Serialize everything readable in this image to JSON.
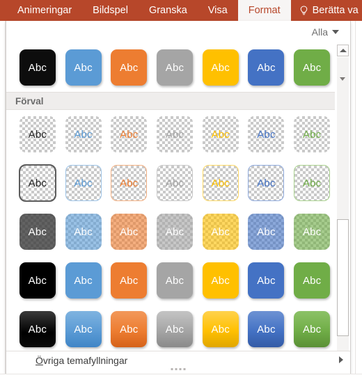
{
  "ribbon": {
    "tabs": [
      {
        "label": "Animeringar",
        "active": false
      },
      {
        "label": "Bildspel",
        "active": false
      },
      {
        "label": "Granska",
        "active": false
      },
      {
        "label": "Visa",
        "active": false
      },
      {
        "label": "Format",
        "active": true
      }
    ],
    "tell_me": {
      "label": "Berätta va",
      "icon": "lightbulb-icon"
    },
    "background_color": "#b7472a",
    "active_tab_background": "#f7f5f4"
  },
  "gallery": {
    "filter": {
      "label": "Alla",
      "icon": "chevron-down-icon"
    },
    "section_header": "Förval",
    "swatch_label": "Abc",
    "rows": [
      {
        "name": "recent-solid",
        "style": "solid",
        "items": [
          {
            "fill": "#0d0d0d",
            "text": "#ffffff",
            "selected": false
          },
          {
            "fill": "#5b9bd5",
            "text": "#ffffff",
            "selected": false
          },
          {
            "fill": "#ed7d31",
            "text": "#ffffff",
            "selected": false
          },
          {
            "fill": "#a5a5a5",
            "text": "#ffffff",
            "selected": false
          },
          {
            "fill": "#ffc000",
            "text": "#ffffff",
            "selected": false
          },
          {
            "fill": "#4472c4",
            "text": "#ffffff",
            "selected": false
          },
          {
            "fill": "#70ad47",
            "text": "#ffffff",
            "selected": false
          }
        ]
      },
      {
        "name": "no-fill-no-line",
        "style": "transparent",
        "items": [
          {
            "fill": "transparent",
            "text": "#262626",
            "border": "none",
            "selected": false
          },
          {
            "fill": "transparent",
            "text": "#5b9bd5",
            "border": "none",
            "selected": false
          },
          {
            "fill": "transparent",
            "text": "#ed7d31",
            "border": "none",
            "selected": false
          },
          {
            "fill": "transparent",
            "text": "#a5a5a5",
            "border": "none",
            "selected": false
          },
          {
            "fill": "transparent",
            "text": "#ffc000",
            "border": "none",
            "selected": false
          },
          {
            "fill": "transparent",
            "text": "#4472c4",
            "border": "none",
            "selected": false
          },
          {
            "fill": "transparent",
            "text": "#70ad47",
            "border": "none",
            "selected": false
          }
        ]
      },
      {
        "name": "outline-only",
        "style": "outline",
        "items": [
          {
            "fill": "transparent",
            "text": "#262626",
            "border": "#404040",
            "selected": true
          },
          {
            "fill": "transparent",
            "text": "#5b9bd5",
            "border": "#9dc3e6",
            "selected": false
          },
          {
            "fill": "transparent",
            "text": "#ed7d31",
            "border": "#f4b183",
            "selected": false
          },
          {
            "fill": "transparent",
            "text": "#a5a5a5",
            "border": "#c9c9c9",
            "selected": false
          },
          {
            "fill": "transparent",
            "text": "#ffc000",
            "border": "#ffd966",
            "selected": false
          },
          {
            "fill": "transparent",
            "text": "#4472c4",
            "border": "#8faadc",
            "selected": false
          },
          {
            "fill": "transparent",
            "text": "#70ad47",
            "border": "#a9d18e",
            "selected": false
          }
        ]
      },
      {
        "name": "semi-transparent-fill",
        "style": "semi",
        "items": [
          {
            "fill": "rgba(64,64,64,0.82)",
            "text": "#ffffff",
            "selected": false
          },
          {
            "fill": "rgba(91,155,213,0.62)",
            "text": "#ffffff",
            "selected": false
          },
          {
            "fill": "rgba(237,125,49,0.62)",
            "text": "#ffffff",
            "selected": false
          },
          {
            "fill": "rgba(165,165,165,0.62)",
            "text": "#ffffff",
            "selected": false
          },
          {
            "fill": "rgba(255,192,0,0.62)",
            "text": "#ffffff",
            "selected": false
          },
          {
            "fill": "rgba(68,114,196,0.62)",
            "text": "#ffffff",
            "selected": false
          },
          {
            "fill": "rgba(112,173,71,0.62)",
            "text": "#ffffff",
            "selected": false
          }
        ]
      },
      {
        "name": "solid-fill",
        "style": "solid-flat",
        "items": [
          {
            "fill": "#000000",
            "text": "#ffffff",
            "selected": false
          },
          {
            "fill": "#5b9bd5",
            "text": "#ffffff",
            "selected": false
          },
          {
            "fill": "#ed7d31",
            "text": "#ffffff",
            "selected": false
          },
          {
            "fill": "#a5a5a5",
            "text": "#ffffff",
            "selected": false
          },
          {
            "fill": "#ffc000",
            "text": "#ffffff",
            "selected": false
          },
          {
            "fill": "#4472c4",
            "text": "#ffffff",
            "selected": false
          },
          {
            "fill": "#70ad47",
            "text": "#ffffff",
            "selected": false
          }
        ]
      },
      {
        "name": "gradient-fill",
        "style": "gradient",
        "items": [
          {
            "fill": "linear-gradient(180deg,#3a3a3a 0%,#000000 60%,#0a0a0a 100%)",
            "text": "#ffffff",
            "selected": false
          },
          {
            "fill": "linear-gradient(180deg,#7fb3e0 0%,#5b9bd5 55%,#3f85c6 100%)",
            "text": "#ffffff",
            "selected": false
          },
          {
            "fill": "linear-gradient(180deg,#f2985a 0%,#ed7d31 55%,#d5621a 100%)",
            "text": "#ffffff",
            "selected": false
          },
          {
            "fill": "linear-gradient(180deg,#c4c4c4 0%,#a5a5a5 55%,#8a8a8a 100%)",
            "text": "#ffffff",
            "selected": false
          },
          {
            "fill": "linear-gradient(180deg,#ffd24d 0%,#ffc000 55%,#e0a600 100%)",
            "text": "#ffffff",
            "selected": false
          },
          {
            "fill": "linear-gradient(180deg,#6d92d3 0%,#4472c4 55%,#335ba6 100%)",
            "text": "#ffffff",
            "selected": false
          },
          {
            "fill": "linear-gradient(180deg,#8cc267 0%,#70ad47 55%,#5a9036 100%)",
            "text": "#ffffff",
            "selected": false
          }
        ]
      }
    ],
    "footer": {
      "more_fills": {
        "accel": "Ö",
        "rest": "vriga temafyllningar",
        "icon": "submenu-arrow-icon"
      }
    },
    "scrollbar": {
      "up_icon": "scroll-up-icon",
      "down_icon": "scroll-down-icon"
    }
  }
}
